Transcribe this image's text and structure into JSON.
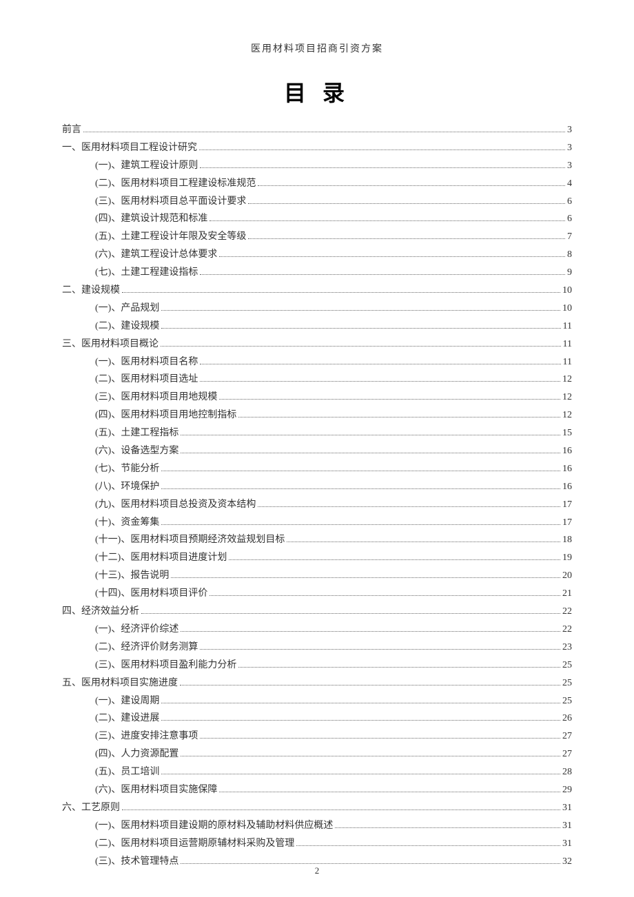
{
  "header": "医用材料项目招商引资方案",
  "title": "目 录",
  "page_number": "2",
  "toc": [
    {
      "level": 0,
      "label": "前言",
      "page": "3"
    },
    {
      "level": 0,
      "label": "一、医用材料项目工程设计研究",
      "page": "3"
    },
    {
      "level": 1,
      "label": "(一)、建筑工程设计原则",
      "page": "3"
    },
    {
      "level": 1,
      "label": "(二)、医用材料项目工程建设标准规范",
      "page": "4"
    },
    {
      "level": 1,
      "label": "(三)、医用材料项目总平面设计要求",
      "page": "6"
    },
    {
      "level": 1,
      "label": "(四)、建筑设计规范和标准",
      "page": "6"
    },
    {
      "level": 1,
      "label": "(五)、土建工程设计年限及安全等级",
      "page": "7"
    },
    {
      "level": 1,
      "label": "(六)、建筑工程设计总体要求",
      "page": "8"
    },
    {
      "level": 1,
      "label": "(七)、土建工程建设指标",
      "page": "9"
    },
    {
      "level": 0,
      "label": "二、建设规模",
      "page": "10"
    },
    {
      "level": 1,
      "label": "(一)、产品规划",
      "page": "10"
    },
    {
      "level": 1,
      "label": "(二)、建设规模",
      "page": "11"
    },
    {
      "level": 0,
      "label": "三、医用材料项目概论",
      "page": "11"
    },
    {
      "level": 1,
      "label": "(一)、医用材料项目名称",
      "page": "11"
    },
    {
      "level": 1,
      "label": "(二)、医用材料项目选址",
      "page": "12"
    },
    {
      "level": 1,
      "label": "(三)、医用材料项目用地规模",
      "page": "12"
    },
    {
      "level": 1,
      "label": "(四)、医用材料项目用地控制指标",
      "page": "12"
    },
    {
      "level": 1,
      "label": "(五)、土建工程指标",
      "page": "15"
    },
    {
      "level": 1,
      "label": "(六)、设备选型方案",
      "page": "16"
    },
    {
      "level": 1,
      "label": "(七)、节能分析",
      "page": "16"
    },
    {
      "level": 1,
      "label": "(八)、环境保护",
      "page": "16"
    },
    {
      "level": 1,
      "label": "(九)、医用材料项目总投资及资本结构",
      "page": "17"
    },
    {
      "level": 1,
      "label": "(十)、资金筹集",
      "page": "17"
    },
    {
      "level": 1,
      "label": "(十一)、医用材料项目预期经济效益规划目标",
      "page": "18"
    },
    {
      "level": 1,
      "label": "(十二)、医用材料项目进度计划",
      "page": "19"
    },
    {
      "level": 1,
      "label": "(十三)、报告说明",
      "page": "20"
    },
    {
      "level": 1,
      "label": "(十四)、医用材料项目评价",
      "page": "21"
    },
    {
      "level": 0,
      "label": "四、经济效益分析",
      "page": "22"
    },
    {
      "level": 1,
      "label": "(一)、经济评价综述",
      "page": "22"
    },
    {
      "level": 1,
      "label": "(二)、经济评价财务测算",
      "page": "23"
    },
    {
      "level": 1,
      "label": "(三)、医用材料项目盈利能力分析",
      "page": "25"
    },
    {
      "level": 0,
      "label": "五、医用材料项目实施进度",
      "page": "25"
    },
    {
      "level": 1,
      "label": "(一)、建设周期",
      "page": "25"
    },
    {
      "level": 1,
      "label": "(二)、建设进展",
      "page": "26"
    },
    {
      "level": 1,
      "label": "(三)、进度安排注意事项",
      "page": "27"
    },
    {
      "level": 1,
      "label": "(四)、人力资源配置",
      "page": "27"
    },
    {
      "level": 1,
      "label": "(五)、员工培训",
      "page": "28"
    },
    {
      "level": 1,
      "label": "(六)、医用材料项目实施保障",
      "page": "29"
    },
    {
      "level": 0,
      "label": "六、工艺原则",
      "page": "31"
    },
    {
      "level": 1,
      "label": "(一)、医用材料项目建设期的原材料及辅助材料供应概述",
      "page": "31"
    },
    {
      "level": 1,
      "label": "(二)、医用材料项目运营期原辅材料采购及管理",
      "page": "31"
    },
    {
      "level": 1,
      "label": "(三)、技术管理特点",
      "page": "32"
    }
  ]
}
